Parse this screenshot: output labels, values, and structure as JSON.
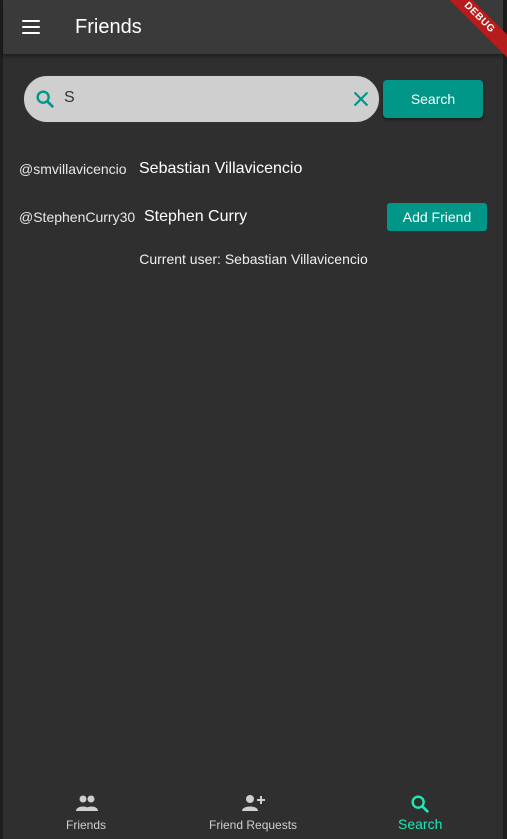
{
  "appbar": {
    "title": "Friends",
    "menu_icon": "menu-icon"
  },
  "debug_banner": "DEBUG",
  "search": {
    "value": "S",
    "button_label": "Search",
    "search_icon": "search-icon",
    "clear_icon": "close-icon"
  },
  "results": [
    {
      "handle": "@smvillavicencio",
      "name": "Sebastian Villavicencio",
      "action": ""
    },
    {
      "handle": "@StephenCurry30",
      "name": "Stephen Curry",
      "action": "Add Friend"
    }
  ],
  "current_user": "Current user: Sebastian Villavicencio",
  "nav": {
    "items": [
      {
        "label": "Friends",
        "icon": "people-icon",
        "active": false
      },
      {
        "label": "Friend Requests",
        "icon": "person-add-icon",
        "active": false
      },
      {
        "label": "Search",
        "icon": "search-icon",
        "active": true
      }
    ]
  },
  "colors": {
    "accent": "#009688",
    "active_nav": "#1de9b6",
    "background": "#2f2f2f",
    "appbar": "#3a3a3a"
  }
}
